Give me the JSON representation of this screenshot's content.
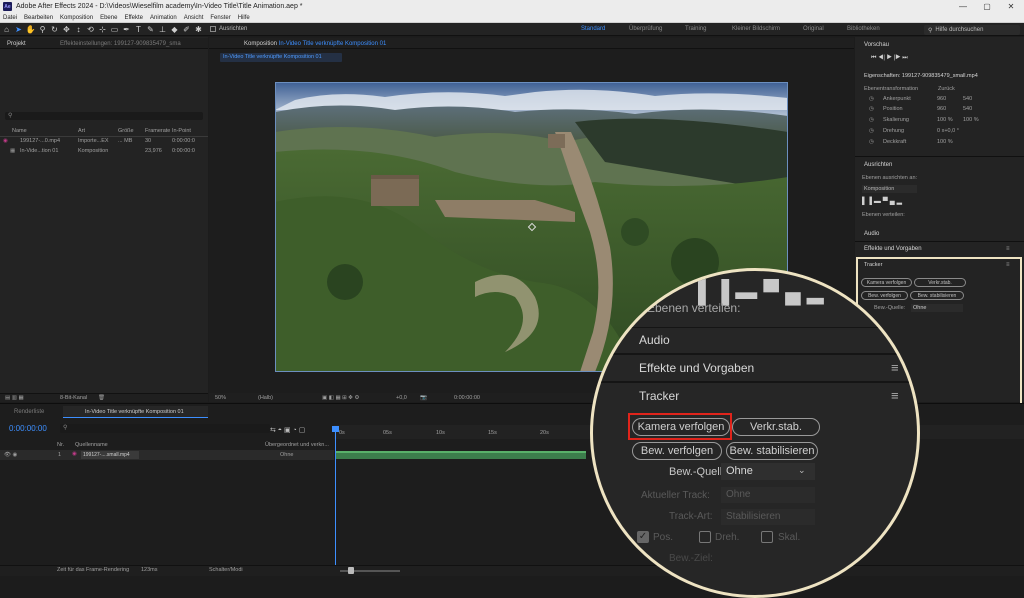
{
  "app": {
    "title": "Adobe After Effects 2024 - D:\\Videos\\Wieselfilm academy\\In-Video Title\\Title Animation.aep *",
    "logo_text": "Ae",
    "window_controls": [
      "—",
      "▢",
      "✕"
    ]
  },
  "menu": [
    "Datei",
    "Bearbeiten",
    "Komposition",
    "Ebene",
    "Effekte",
    "Animation",
    "Ansicht",
    "Fenster",
    "Hilfe"
  ],
  "toolbar": {
    "icons": [
      "home-icon",
      "selection-tool-icon",
      "hand-tool-icon",
      "zoom-tool-icon",
      "orbit-icon",
      "pan-icon",
      "dolly-icon",
      "rotate-icon",
      "anchor-icon",
      "mask-tool-icon",
      "pen-tool-icon",
      "type-tool-icon",
      "brush-icon",
      "stamp-icon",
      "eraser-icon",
      "roto-icon",
      "puppet-icon"
    ],
    "align_label": "Ausrichten",
    "workspaces": [
      "Standard",
      "Überprüfung",
      "Training",
      "Kleiner Bildschirm",
      "Original",
      "Bibliotheken"
    ],
    "active_workspace": "Standard",
    "search_placeholder": "Hilfe durchsuchen"
  },
  "project_panel": {
    "tab_project": "Projekt",
    "tab_effects": "Effekteinstellungen: 199127-909835479_sma",
    "columns": [
      "Name",
      "Art",
      "Größe",
      "Framerate",
      "In-Point"
    ],
    "items": [
      {
        "name": "199127-...0.mp4",
        "type": "Importe...EX",
        "size": "... MB",
        "fps": "30",
        "in": "0:00:00:0"
      },
      {
        "name": "In-Vide...tion 01",
        "type": "Komposition",
        "size": "",
        "fps": "23,976",
        "in": "0:00:00:0"
      }
    ],
    "bpc": "8-Bit-Kanal"
  },
  "composition_panel": {
    "tab": "Komposition",
    "comp_name": "In-Video Title verknüpfte Komposition 01",
    "breadcrumb": "In-Video Title verknüpfte Komposition 01",
    "zoom": "50%",
    "quality": "(Halb)",
    "exposure": "+0,0",
    "timecode": "0:00:00:00"
  },
  "right_panel": {
    "preview": "Vorschau",
    "properties_title": "Eigenschaften: 199127-909835479_small.mp4",
    "layer_transform": "Ebenentransformation",
    "reset": "Zurück",
    "props": [
      {
        "label": "Ankerpunkt",
        "v1": "960",
        "v2": "540"
      },
      {
        "label": "Position",
        "v1": "960",
        "v2": "540"
      },
      {
        "label": "Skalierung",
        "v1": "100 %",
        "v2": "100 %"
      },
      {
        "label": "Drehung",
        "v1": "0 x+0,0 °",
        "v2": ""
      },
      {
        "label": "Deckkraft",
        "v1": "100 %",
        "v2": ""
      }
    ],
    "align": "Ausrichten",
    "align_to": "Ebenen ausrichten an:",
    "align_target": "Komposition",
    "distribute": "Ebenen verteilen:",
    "audio": "Audio",
    "effects": "Effekte und Vorgaben",
    "tracker": {
      "title": "Tracker",
      "track_camera": "Kamera verfolgen",
      "warp_stab": "Verkr.stab.",
      "track_motion": "Bew. verfolgen",
      "stabilize": "Bew. stabilisieren",
      "motion_source_label": "Bew.-Quelle:",
      "motion_source_value": "Ohne",
      "current_track": "Aktueller Track:",
      "current_track_value": "Ohne",
      "track_type": "Track-Art:",
      "track_type_value": "Stabilisieren",
      "pos": "Pos.",
      "rot": "Dreh.",
      "scale": "Skal.",
      "motion_target": "Bew.-Ziel:"
    }
  },
  "timeline": {
    "render_queue": "Renderliste",
    "tab": "In-Video Title verknüpfte Komposition 01",
    "timecode": "0:00:00:00",
    "columns": [
      "Nr.",
      "Quellenname",
      "Übergeordnet und verkn..."
    ],
    "layers": [
      {
        "num": "1",
        "name": "199127-....small.mp4",
        "parent": "Ohne"
      }
    ],
    "ruler": [
      "0s",
      "05s",
      "10s",
      "15s",
      "20s"
    ],
    "frame_render": "Zeit für das Frame-Rendering",
    "frame_time": "123ms",
    "switches": "Schalter/Modi"
  },
  "colors": {
    "accent": "#3d8fff",
    "highlight_red": "#e0241b",
    "annotation_frame": "#eee3c2"
  }
}
